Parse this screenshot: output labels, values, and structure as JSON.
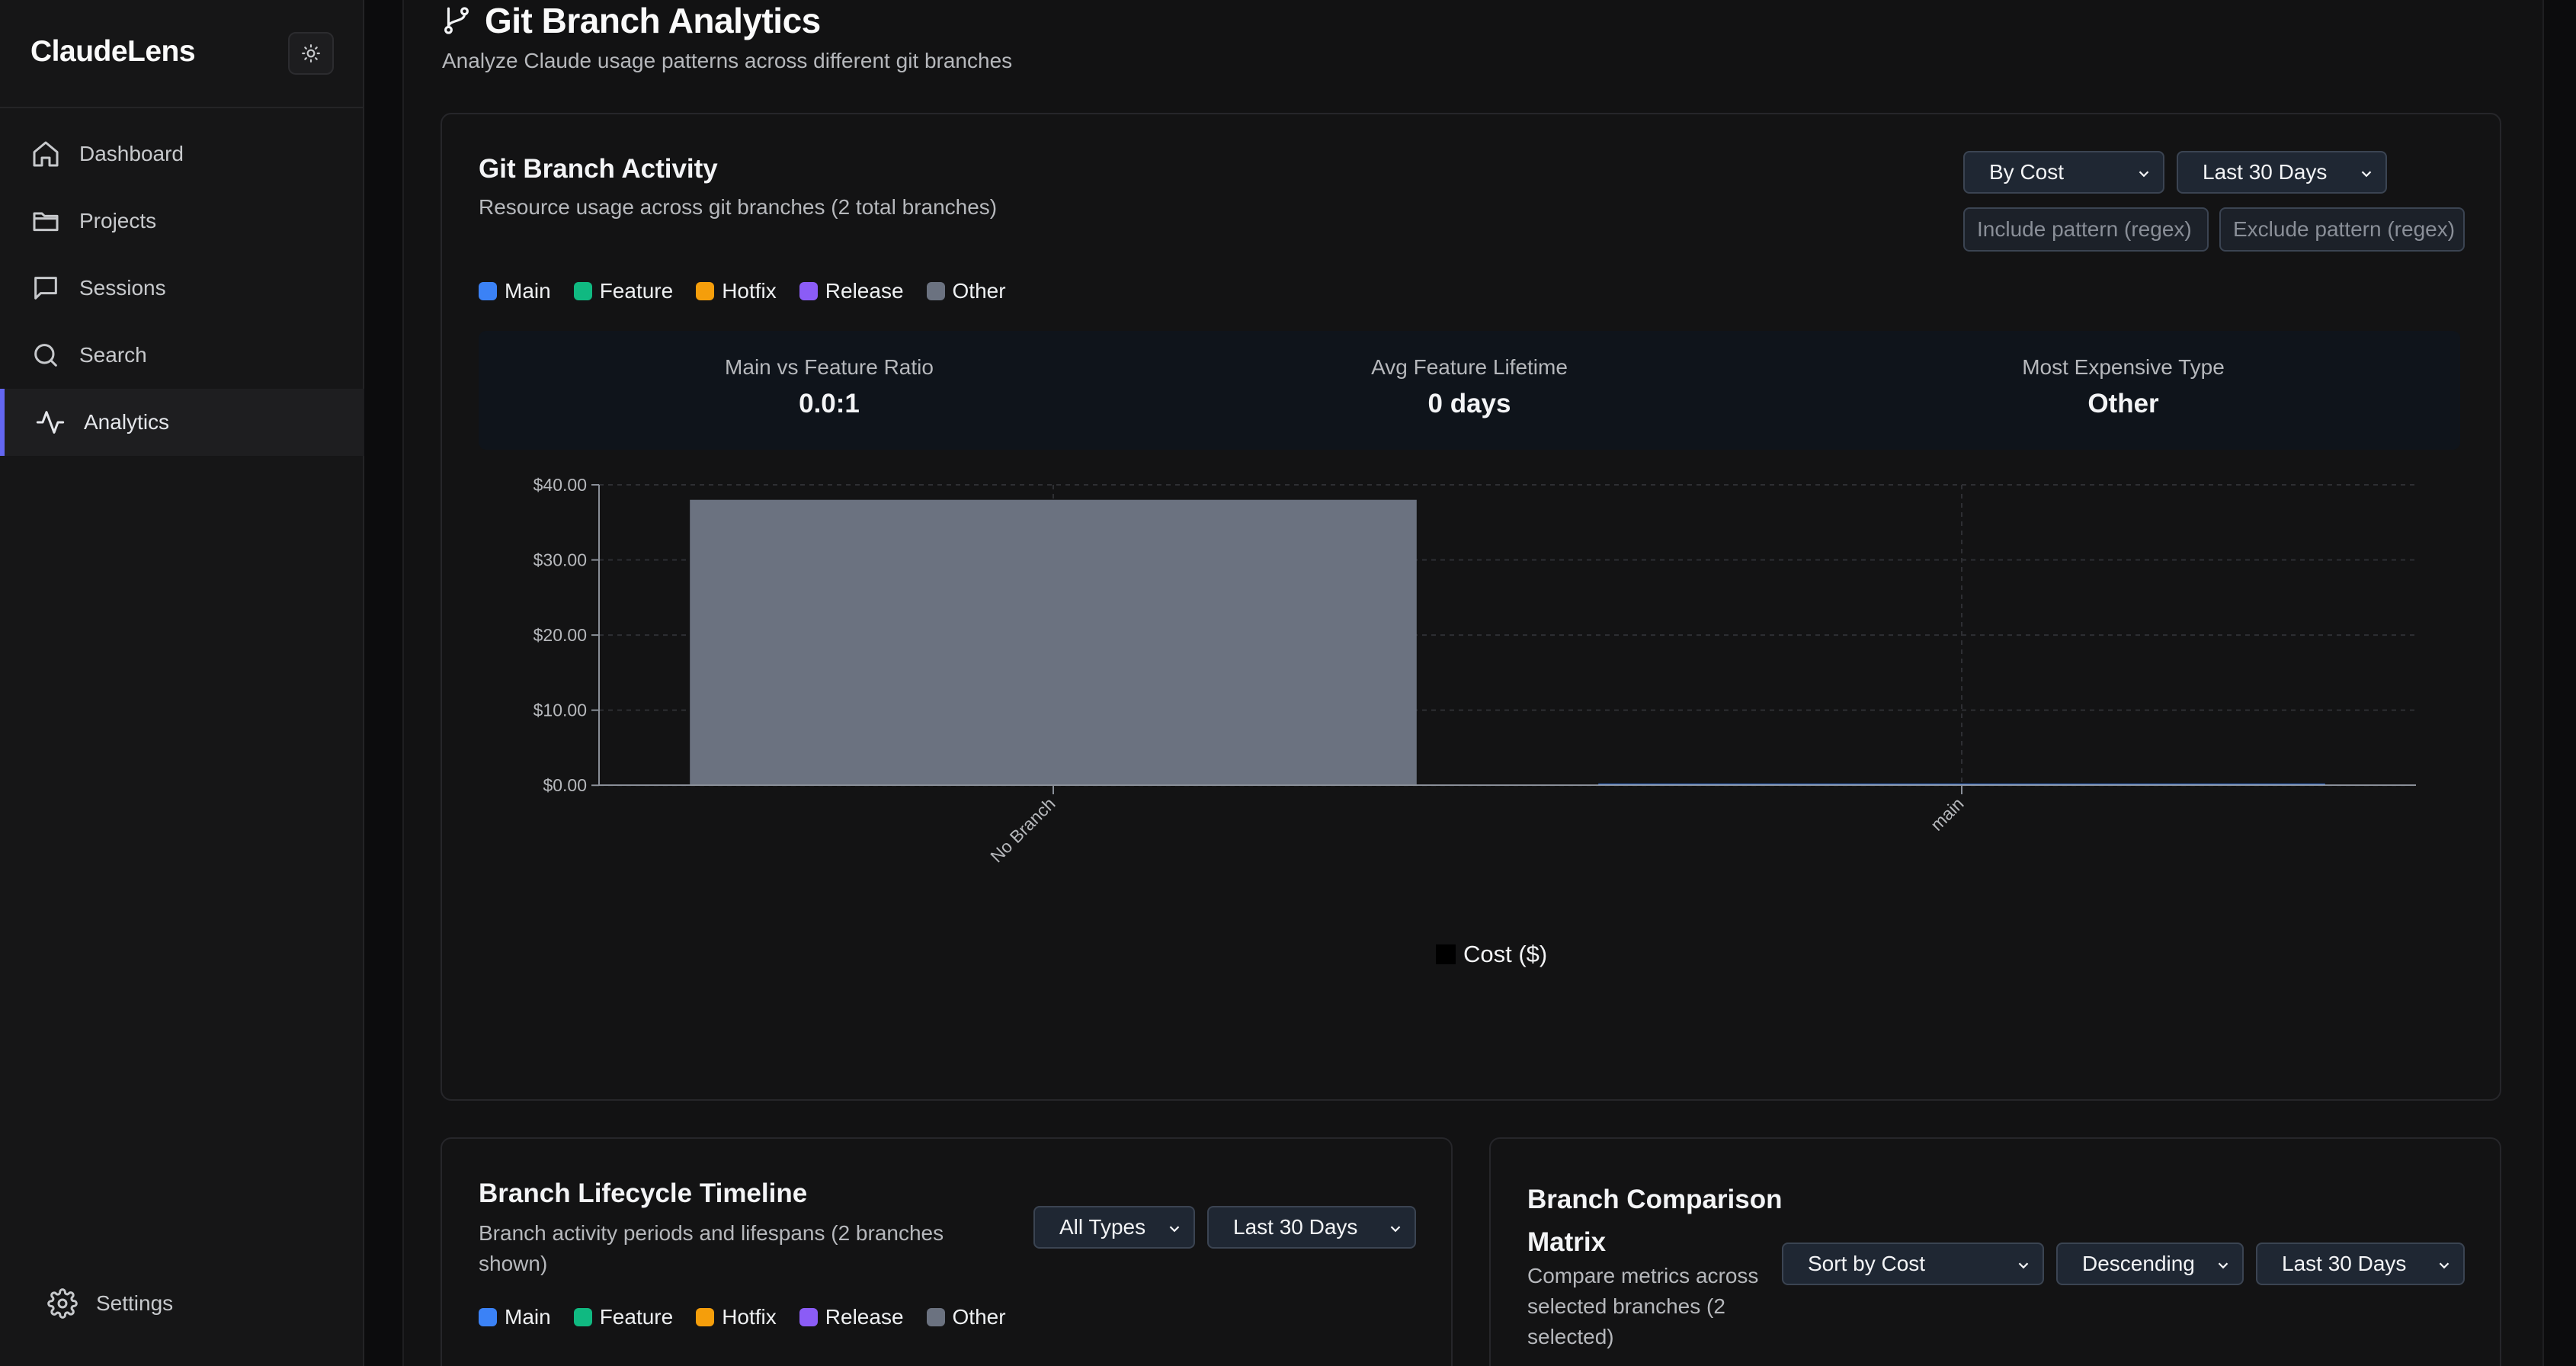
{
  "sidebar": {
    "brand": "ClaudeLens",
    "theme_toggle_icon": "sun-icon",
    "items": [
      {
        "label": "Dashboard",
        "icon": "home-icon"
      },
      {
        "label": "Projects",
        "icon": "folder-icon"
      },
      {
        "label": "Sessions",
        "icon": "message-icon"
      },
      {
        "label": "Search",
        "icon": "search-icon"
      },
      {
        "label": "Analytics",
        "icon": "activity-icon",
        "active": true
      }
    ],
    "settings": {
      "label": "Settings",
      "icon": "gear-icon"
    }
  },
  "page": {
    "title": "Git Branch Analytics",
    "title_icon": "git-branch-icon",
    "subtitle": "Analyze Claude usage patterns across different git branches"
  },
  "activity_card": {
    "title": "Git Branch Activity",
    "subtitle": "Resource usage across git branches (2 total branches)",
    "metric_select": "By Cost",
    "range_select": "Last 30 Days",
    "include_placeholder": "Include pattern (regex)",
    "exclude_placeholder": "Exclude pattern (regex)",
    "legend": [
      {
        "label": "Main",
        "color": "#3b82f6"
      },
      {
        "label": "Feature",
        "color": "#10b981"
      },
      {
        "label": "Hotfix",
        "color": "#f59e0b"
      },
      {
        "label": "Release",
        "color": "#8b5cf6"
      },
      {
        "label": "Other",
        "color": "#6b7280"
      }
    ],
    "stats": [
      {
        "label": "Main vs Feature Ratio",
        "value": "0.0:1"
      },
      {
        "label": "Avg Feature Lifetime",
        "value": "0 days"
      },
      {
        "label": "Most Expensive Type",
        "value": "Other"
      }
    ]
  },
  "chart_data": {
    "type": "bar",
    "categories": [
      "No Branch",
      "main"
    ],
    "values": [
      38.0,
      0.1
    ],
    "bar_colors": [
      "#6b7280",
      "#3b82f6"
    ],
    "ylim": [
      0,
      40
    ],
    "yticks": [
      "$0.00",
      "$10.00",
      "$20.00",
      "$30.00",
      "$40.00"
    ],
    "grid": true,
    "legend_label": "Cost ($)",
    "legend_placement": "bottom-center"
  },
  "lifecycle_card": {
    "title": "Branch Lifecycle Timeline",
    "subtitle": "Branch activity periods and lifespans (2 branches shown)",
    "type_select": "All Types",
    "range_select": "Last 30 Days",
    "legend": [
      {
        "label": "Main",
        "color": "#3b82f6"
      },
      {
        "label": "Feature",
        "color": "#10b981"
      },
      {
        "label": "Hotfix",
        "color": "#f59e0b"
      },
      {
        "label": "Release",
        "color": "#8b5cf6"
      },
      {
        "label": "Other",
        "color": "#6b7280"
      }
    ]
  },
  "comparison_card": {
    "title_line1": "Branch Comparison",
    "title_line2": "Matrix",
    "subtitle": "Compare metrics across selected branches (2 selected)",
    "sort_select": "Sort by Cost",
    "order_select": "Descending",
    "range_select": "Last 30 Days"
  }
}
